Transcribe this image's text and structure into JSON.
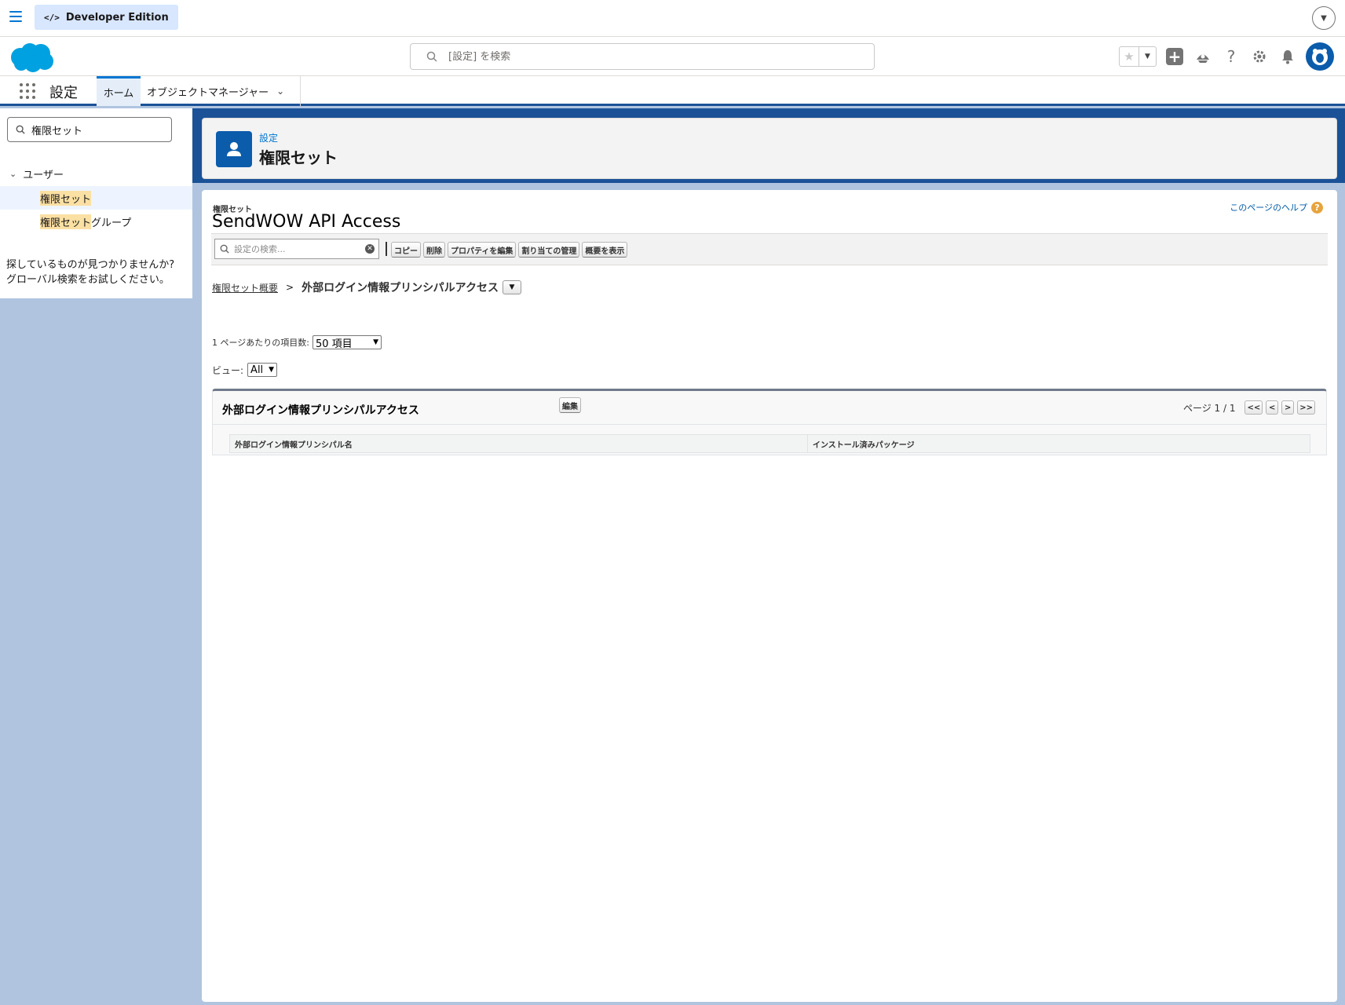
{
  "topbar": {
    "edition_label": "Developer Edition",
    "edition_icon": "code-icon"
  },
  "header": {
    "search_placeholder": "[設定] を検索",
    "icons": [
      "favorites-star-icon",
      "add-icon",
      "trailhead-icon",
      "help-icon",
      "gear-icon",
      "bell-icon",
      "avatar"
    ]
  },
  "nav": {
    "app_name": "設定",
    "tabs": [
      {
        "label": "ホーム",
        "active": true
      },
      {
        "label": "オブジェクトマネージャー",
        "active": false
      }
    ]
  },
  "sidebar": {
    "search_value": "権限セット",
    "group_label": "ユーザー",
    "items": [
      {
        "highlight": "権限セット",
        "rest": "",
        "active": true
      },
      {
        "highlight": "権限セット",
        "rest": "グループ",
        "active": false
      }
    ],
    "help_line1": "探しているものが見つかりませんか?",
    "help_line2": "グローバル検索をお試しください。"
  },
  "page_header": {
    "subtitle": "設定",
    "title": "権限セット"
  },
  "content": {
    "subtitle": "権限セット",
    "title": "SendWOW API Access",
    "help_link": "このページのヘルプ",
    "toolbar": {
      "search_placeholder": "設定の検索...",
      "buttons": [
        "コピー",
        "削除",
        "プロパティを編集",
        "割り当ての管理",
        "概要を表示"
      ]
    },
    "breadcrumb": {
      "link": "権限セット概要",
      "separator": ">",
      "current": "外部ログイン情報プリンシパルアクセス"
    },
    "per_page_label": "1 ページあたりの項目数:",
    "per_page_value": "50 項目",
    "view_label": "ビュー:",
    "view_value": "All",
    "related_list": {
      "title": "外部ログイン情報プリンシパルアクセス",
      "edit_button": "編集",
      "pager_label": "ページ 1 / 1",
      "pager_buttons": [
        "<<",
        "<",
        ">",
        ">>"
      ],
      "columns": [
        "外部ログイン情報プリンシパル名",
        "インストール済みパッケージ"
      ]
    }
  }
}
